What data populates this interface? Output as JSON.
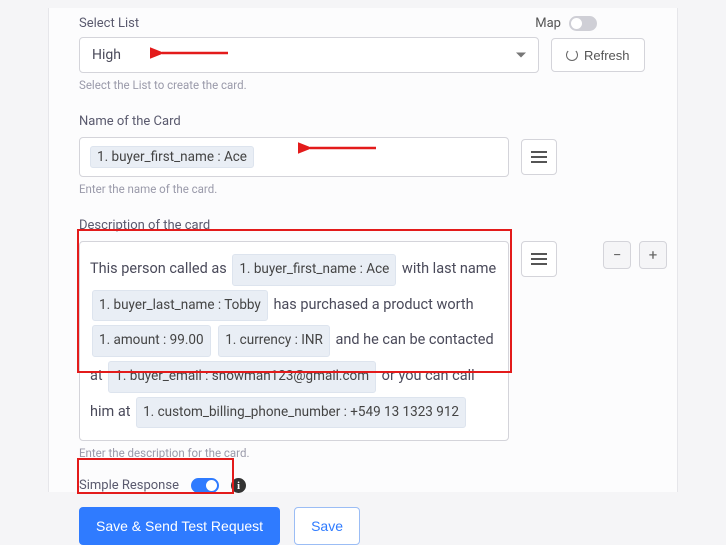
{
  "selectList": {
    "label": "Select List",
    "mapLabel": "Map",
    "value": "High",
    "helper": "Select the List to create the card.",
    "refreshLabel": "Refresh"
  },
  "cardName": {
    "label": "Name of the Card",
    "token": "1. buyer_first_name : Ace",
    "helper": "Enter the name of the card."
  },
  "description": {
    "label": "Description of the card",
    "text1": "This person called as",
    "token1": "1. buyer_first_name : Ace",
    "text2": "with last name",
    "token2": "1. buyer_last_name : Tobby",
    "text3": "has purchased a product worth",
    "token3": "1. amount : 99.00",
    "token4": "1. currency : INR",
    "text4": "and he can be contacted at",
    "token5": "1. buyer_email : snowman123@gmail.com",
    "text5": "or you can call him at",
    "token6": "1. custom_billing_phone_number : +549 13 1323 912",
    "helper": "Enter the description for the card."
  },
  "simpleResponse": {
    "label": "Simple Response"
  },
  "buttons": {
    "saveSend": "Save & Send Test Request",
    "save": "Save"
  },
  "controls": {
    "minus": "−",
    "plus": "+"
  }
}
